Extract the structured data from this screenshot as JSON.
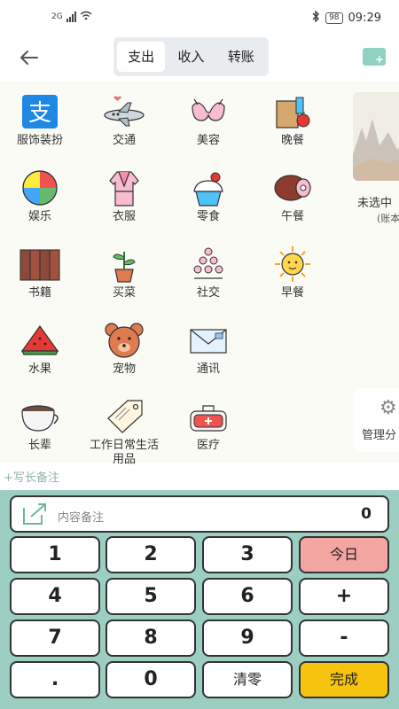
{
  "status_bar": {
    "network": "2G",
    "bluetooth": "bluetooth-icon",
    "battery": "98",
    "time": "09:29"
  },
  "header": {
    "tabs": [
      {
        "label": "支出",
        "active": true
      },
      {
        "label": "收入",
        "active": false
      },
      {
        "label": "转账",
        "active": false
      }
    ]
  },
  "categories": [
    {
      "label": "服饰装扮",
      "icon": "alipay-icon"
    },
    {
      "label": "交通",
      "icon": "airplane-icon"
    },
    {
      "label": "美容",
      "icon": "bra-icon"
    },
    {
      "label": "晚餐",
      "icon": "grocery-bag-icon"
    },
    {
      "label": "娱乐",
      "icon": "beach-ball-icon"
    },
    {
      "label": "衣服",
      "icon": "robe-icon"
    },
    {
      "label": "零食",
      "icon": "cupcake-icon"
    },
    {
      "label": "午餐",
      "icon": "ham-icon"
    },
    {
      "label": "书籍",
      "icon": "books-icon"
    },
    {
      "label": "买菜",
      "icon": "potted-plant-icon"
    },
    {
      "label": "社交",
      "icon": "champagne-tower-icon"
    },
    {
      "label": "早餐",
      "icon": "sun-icon"
    },
    {
      "label": "水果",
      "icon": "watermelon-icon"
    },
    {
      "label": "宠物",
      "icon": "bear-icon"
    },
    {
      "label": "通讯",
      "icon": "envelope-icon"
    },
    {
      "label": "长辈",
      "icon": "coffee-cup-icon"
    },
    {
      "label": "工作日常生活用品",
      "icon": "price-tag-icon"
    },
    {
      "label": "医疗",
      "icon": "medical-kit-icon"
    }
  ],
  "right_panel": {
    "card_text": "未选中",
    "card_sub": "(账本",
    "manage_label": "管理分"
  },
  "long_note": "+写长备注",
  "keypad": {
    "memo_placeholder": "内容备注",
    "amount": "0",
    "keys": [
      [
        "1",
        "2",
        "3",
        "今日"
      ],
      [
        "4",
        "5",
        "6",
        "+"
      ],
      [
        "7",
        "8",
        "9",
        "-"
      ],
      [
        ".",
        "0",
        "清零",
        "完成"
      ]
    ]
  },
  "colors": {
    "accent": "#9ccfc1",
    "today_key": "#f2a5a1",
    "done_key": "#f6c40f"
  }
}
